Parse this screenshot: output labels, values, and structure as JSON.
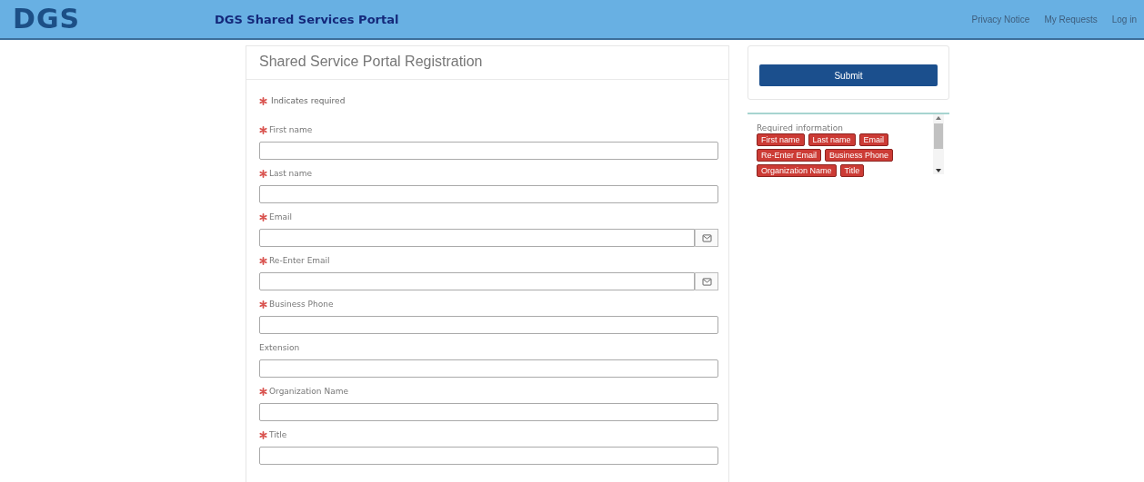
{
  "header": {
    "logo": "DGS",
    "title": "DGS Shared Services Portal",
    "nav": [
      "Privacy Notice",
      "My Requests",
      "Log in"
    ]
  },
  "form": {
    "title": "Shared Service Portal Registration",
    "required_note": "Indicates required",
    "fields": [
      {
        "label": "First name",
        "required": true,
        "kind": "text"
      },
      {
        "label": "Last name",
        "required": true,
        "kind": "text"
      },
      {
        "label": "Email",
        "required": true,
        "kind": "email"
      },
      {
        "label": "Re-Enter Email",
        "required": true,
        "kind": "email"
      },
      {
        "label": "Business Phone",
        "required": true,
        "kind": "text"
      },
      {
        "label": "Extension",
        "required": false,
        "kind": "text"
      },
      {
        "label": "Organization Name",
        "required": true,
        "kind": "text"
      },
      {
        "label": "Title",
        "required": true,
        "kind": "text"
      }
    ]
  },
  "actions": {
    "submit": "Submit"
  },
  "required_info": {
    "heading": "Required information",
    "tags": [
      "First name",
      "Last name",
      "Email",
      "Re-Enter Email",
      "Business Phone",
      "Organization Name",
      "Title"
    ]
  }
}
